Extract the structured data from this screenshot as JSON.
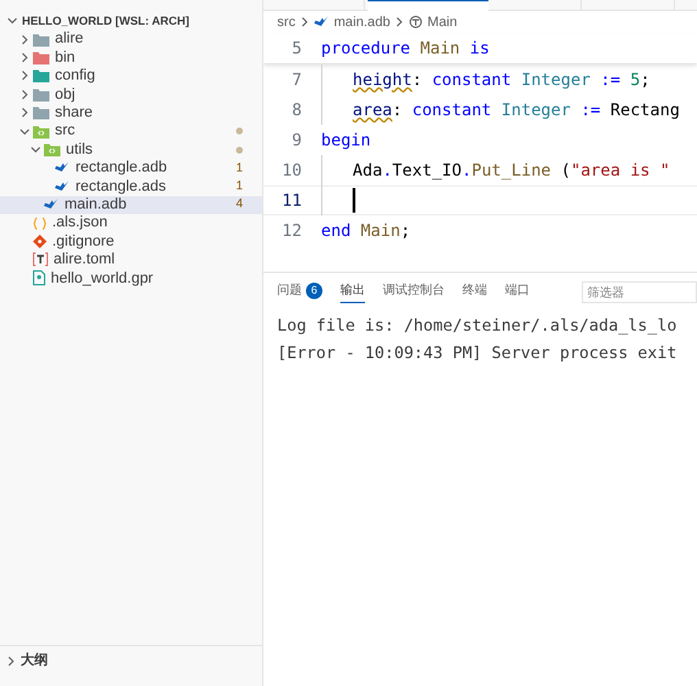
{
  "editor_tabs": [
    {
      "selected": false
    },
    {
      "selected": true
    },
    {
      "selected": false
    },
    {
      "selected": false
    }
  ],
  "explorer": {
    "root": {
      "label": "HELLO_WORLD [WSL: ARCH]",
      "expanded": true
    },
    "items": [
      {
        "label": "alire",
        "kind": "folder",
        "expanded": false,
        "selected": false
      },
      {
        "label": "bin",
        "kind": "binfolder",
        "expanded": false,
        "selected": false
      },
      {
        "label": "config",
        "kind": "configfolder",
        "expanded": false,
        "selected": false
      },
      {
        "label": "obj",
        "kind": "folder",
        "expanded": false,
        "selected": false
      },
      {
        "label": "share",
        "kind": "folder",
        "expanded": false,
        "selected": false
      },
      {
        "label": "src",
        "kind": "sourcefolder",
        "expanded": true,
        "selected": false,
        "modified": true,
        "children": [
          {
            "label": "utils",
            "kind": "sourcefolder",
            "expanded": true,
            "selected": false,
            "modified": true,
            "children": [
              {
                "label": "rectangle.adb",
                "kind": "adafile",
                "selected": false,
                "badge": "1"
              },
              {
                "label": "rectangle.ads",
                "kind": "adafile",
                "selected": false,
                "badge": "1"
              }
            ]
          },
          {
            "label": "main.adb",
            "kind": "adafile",
            "selected": true,
            "badge": "4"
          }
        ]
      },
      {
        "label": ".als.json",
        "kind": "jsonfile",
        "selected": false
      },
      {
        "label": ".gitignore",
        "kind": "gitfile",
        "selected": false
      },
      {
        "label": "alire.toml",
        "kind": "tomlfile",
        "selected": false
      },
      {
        "label": "hello_world.gpr",
        "kind": "projectfile",
        "selected": false
      }
    ]
  },
  "outline": {
    "label": "大纲",
    "expanded": false
  },
  "breadcrumb": [
    "src",
    "main.adb",
    "Main"
  ],
  "code": [
    {
      "number": "5",
      "sticky": true,
      "tokens": [
        {
          "kind": "keyword",
          "text": "procedure "
        },
        {
          "kind": "ident",
          "text": "Main"
        },
        {
          "kind": "keyword",
          "text": " is"
        }
      ]
    },
    {
      "number": "7",
      "indent": true,
      "tokens": [
        {
          "kind": "var",
          "text": "height",
          "warning": true
        },
        {
          "kind": "plain",
          "text": ": "
        },
        {
          "kind": "keyword",
          "text": "constant "
        },
        {
          "kind": "type",
          "text": "Integer"
        },
        {
          "kind": "op",
          "text": " := "
        },
        {
          "kind": "number",
          "text": "5"
        },
        {
          "kind": "plain",
          "text": ";"
        }
      ]
    },
    {
      "number": "8",
      "indent": true,
      "tokens": [
        {
          "kind": "var",
          "text": "area",
          "warning": true
        },
        {
          "kind": "plain",
          "text": ": "
        },
        {
          "kind": "keyword",
          "text": "constant "
        },
        {
          "kind": "type",
          "text": "Integer"
        },
        {
          "kind": "op",
          "text": " := "
        },
        {
          "kind": "plain",
          "text": "Rectang"
        }
      ]
    },
    {
      "number": "9",
      "tokens": [
        {
          "kind": "keyword",
          "text": "begin"
        }
      ]
    },
    {
      "number": "10",
      "indent": true,
      "tokens": [
        {
          "kind": "plain",
          "text": "Ada"
        },
        {
          "kind": "op",
          "text": "."
        },
        {
          "kind": "plain",
          "text": "Text_IO"
        },
        {
          "kind": "op",
          "text": "."
        },
        {
          "kind": "ident",
          "text": "Put_Line"
        },
        {
          "kind": "plain",
          "text": " ("
        },
        {
          "kind": "string",
          "text": "\"area is \""
        }
      ]
    },
    {
      "number": "11",
      "indent": true,
      "current": true
    },
    {
      "number": "12",
      "tokens": [
        {
          "kind": "keyword",
          "text": "end "
        },
        {
          "kind": "ident",
          "text": "Main"
        },
        {
          "kind": "plain",
          "text": ";"
        }
      ]
    }
  ],
  "panel": {
    "tabs": [
      {
        "label": "问题",
        "badge": "6",
        "selected": false
      },
      {
        "label": "输出",
        "selected": true
      },
      {
        "label": "调试控制台",
        "selected": false
      },
      {
        "label": "终端",
        "selected": false
      },
      {
        "label": "端口",
        "selected": false
      }
    ],
    "filter": {
      "placeholder": "筛选器"
    },
    "output": [
      "Log file is: /home/steiner/.als/ada_ls_lo",
      "[Error - 10:09:43 PM] Server process exit"
    ]
  }
}
